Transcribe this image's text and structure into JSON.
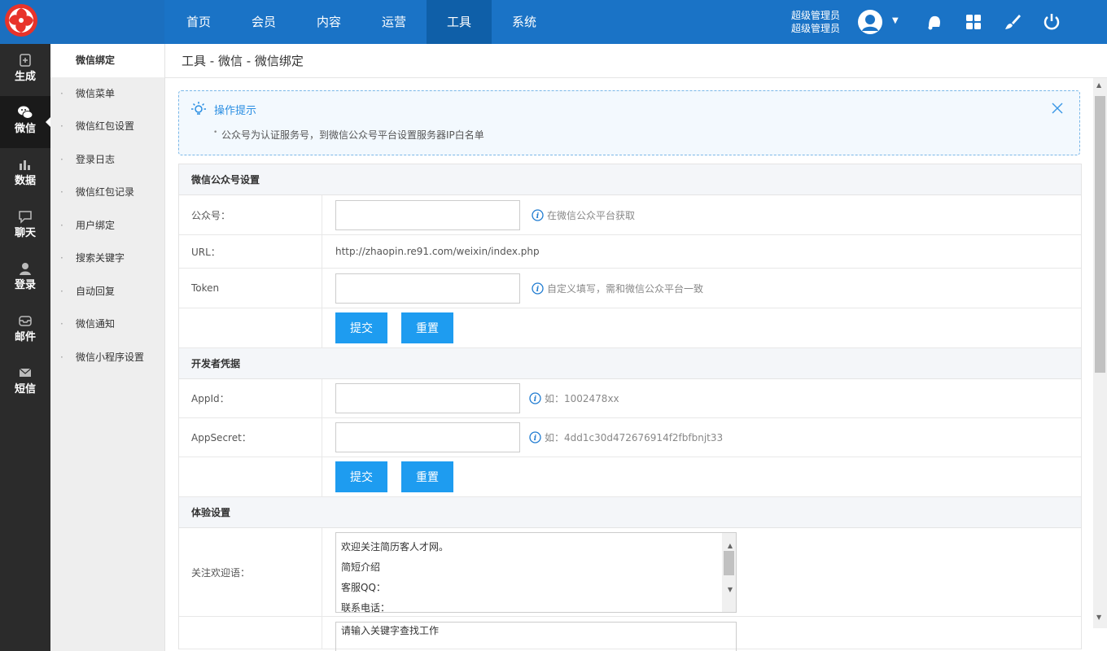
{
  "topbar": {
    "nav": [
      "首页",
      "会员",
      "内容",
      "运营",
      "工具",
      "系统"
    ],
    "active_nav": 4,
    "user_name_line1": "超级管理员",
    "user_name_line2": "超级管理员",
    "icons": [
      "avatar-icon",
      "bell-icon",
      "apps-icon",
      "brush-icon",
      "power-icon"
    ]
  },
  "rail": {
    "items": [
      {
        "label": "生成",
        "icon": "generate-icon"
      },
      {
        "label": "微信",
        "icon": "wechat-icon"
      },
      {
        "label": "数据",
        "icon": "chart-icon"
      },
      {
        "label": "聊天",
        "icon": "chat-icon"
      },
      {
        "label": "登录",
        "icon": "user-icon"
      },
      {
        "label": "邮件",
        "icon": "mailbox-icon"
      },
      {
        "label": "短信",
        "icon": "envelope-icon"
      }
    ],
    "active": 1
  },
  "submenu": {
    "items": [
      "微信绑定",
      "微信菜单",
      "微信红包设置",
      "登录日志",
      "微信红包记录",
      "用户绑定",
      "搜索关键字",
      "自动回复",
      "微信通知",
      "微信小程序设置"
    ],
    "active": 0
  },
  "breadcrumb": "工具 - 微信 - 微信绑定",
  "tip": {
    "title": "操作提示",
    "text": "公众号为认证服务号，到微信公众号平台设置服务器IP白名单"
  },
  "sections": {
    "wechat": {
      "title": "微信公众号设置",
      "account_label": "公众号：",
      "account_value": "",
      "account_hint": "在微信公众平台获取",
      "url_label": "URL：",
      "url_value": "http://zhaopin.re91.com/weixin/index.php",
      "token_label": "Token",
      "token_value": "",
      "token_hint": "自定义填写，需和微信公众平台一致"
    },
    "developer": {
      "title": "开发者凭据",
      "appid_label": "AppId：",
      "appid_value": "",
      "appid_hint": "如：1002478xx",
      "secret_label": "AppSecret：",
      "secret_value": "",
      "secret_hint": "如：4dd1c30d472676914f2fbfbnjt33"
    },
    "experience": {
      "title": "体验设置",
      "welcome_label": "关注欢迎语：",
      "welcome_lines": [
        "欢迎关注简历客人才网。",
        "简短介绍",
        "客服QQ：",
        "联系电话："
      ],
      "next_placeholder_partial": "请输入关键字查找工作"
    }
  },
  "buttons": {
    "submit": "提交",
    "reset": "重置"
  }
}
